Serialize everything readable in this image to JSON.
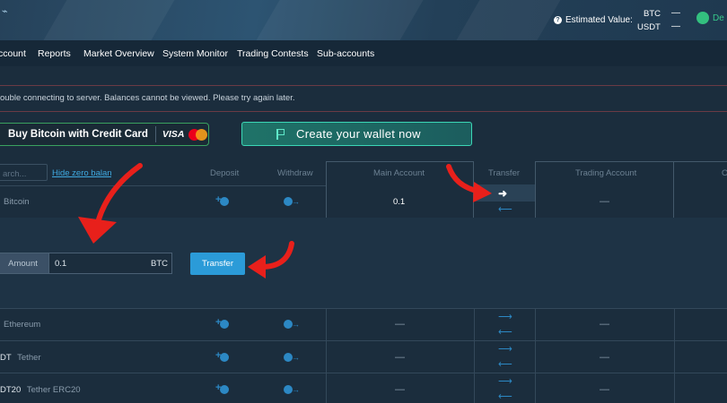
{
  "header": {
    "logo_fragment": "⌁",
    "estimated_label": "Estimated Value:",
    "btc_label": "BTC",
    "btc_value": "—",
    "usdt_label": "USDT",
    "usdt_value": "—",
    "deposit_label": "De"
  },
  "nav": {
    "tabs": [
      "ccount",
      "Reports",
      "Market Overview",
      "System Monitor",
      "Trading Contests",
      "Sub-accounts"
    ]
  },
  "error_message": "ouble connecting to server. Balances cannot be viewed. Please try again later.",
  "buy_button": {
    "label": "Buy Bitcoin with Credit Card",
    "visa": "VISA"
  },
  "wallet_button": {
    "label": "Create your wallet now"
  },
  "search": {
    "placeholder": "arch..."
  },
  "hide_zero": "Hide zero balances",
  "columns": {
    "deposit": "Deposit",
    "withdraw": "Withdraw",
    "main": "Main Account",
    "transfer": "Transfer",
    "trading": "Trading Account",
    "other": "O"
  },
  "rows": [
    {
      "code": "",
      "name": "Bitcoin",
      "main": "0.1",
      "trading": "—"
    },
    {
      "code": "",
      "name": "Ethereum",
      "main": "—",
      "trading": "—"
    },
    {
      "code": "DT",
      "name": "Tether",
      "main": "—",
      "trading": "—"
    },
    {
      "code": "DT20",
      "name": "Tether ERC20",
      "main": "—",
      "trading": "—"
    }
  ],
  "transfer_form": {
    "amount_label": "Amount",
    "amount_value": "0.1",
    "unit": "BTC",
    "button": "Transfer"
  },
  "icons": {
    "deposit": "deposit-icon",
    "withdraw": "withdraw-icon",
    "transfer_right": "arrow-right-icon",
    "transfer_left": "arrow-left-icon"
  },
  "colors": {
    "background": "#1b2d3d",
    "accent_blue": "#2b9bd8",
    "accent_green": "#33c07f",
    "annotation_red": "#e8201b"
  }
}
